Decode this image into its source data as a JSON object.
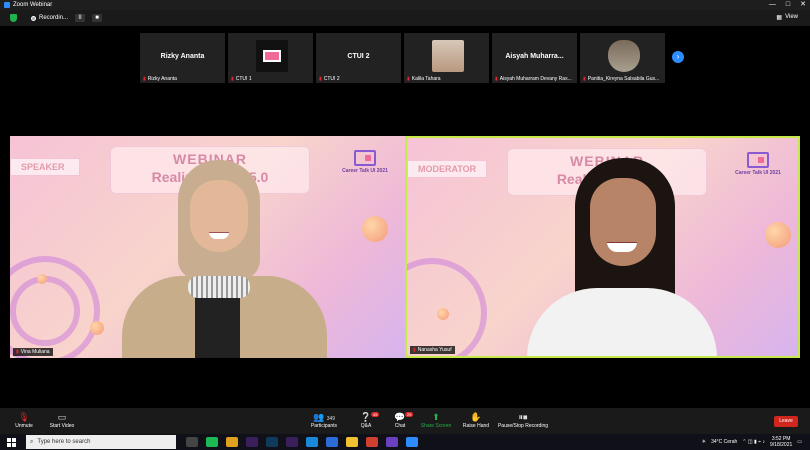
{
  "window": {
    "title": "Zoom Webinar",
    "controls": [
      "—",
      "□",
      "✕"
    ]
  },
  "info": {
    "recording": "Recordin...",
    "pause": "II",
    "stop": "■",
    "view": "View"
  },
  "thumbnails": [
    {
      "name": "Rizky Ananta",
      "label": "Rizky Ananta",
      "type": "text"
    },
    {
      "name": "",
      "label": "CTUI 1",
      "type": "logo"
    },
    {
      "name": "CTUI 2",
      "label": "CTUI 2",
      "type": "text"
    },
    {
      "name": "",
      "label": "Kalila Tahara",
      "type": "face"
    },
    {
      "name": "Aisyah  Muharra...",
      "label": "Aisyah Muharram Devany Ras...",
      "type": "text"
    },
    {
      "name": "",
      "label": "Panitia_Kireyna Salsabila Gus...",
      "type": "face2"
    }
  ],
  "tiles": {
    "left": {
      "role": "SPEAKER",
      "banner_line1": "WEBINAR",
      "banner_line2": "Realizing ... ty 5.0",
      "brand": "Career Talk UI 2021",
      "name": "Vina Muliana"
    },
    "right": {
      "role": "MODERATOR",
      "banner_line1": "WEBINAR",
      "banner_line2": "Realizing ... 5.0",
      "brand": "Career Talk UI 2021",
      "name": "Nanasha Yusuf"
    }
  },
  "controls": {
    "unmute": "Unmute",
    "start_video": "Start Video",
    "participants": "Participants",
    "participants_count": "349",
    "qa": "Q&A",
    "qa_badge": "45",
    "chat": "Chat",
    "chat_badge": "29",
    "share": "Share Screen",
    "raise": "Raise Hand",
    "record": "Pause/Stop Recording",
    "leave": "Leave"
  },
  "taskbar": {
    "search": "Type here to search",
    "weather": "34°C Cerah",
    "time": "3:52 PM",
    "date": "9/18/2021"
  },
  "colors": {
    "accent": "#2d8cff",
    "active_border": "#c7e84a",
    "leave": "#d0261e"
  }
}
